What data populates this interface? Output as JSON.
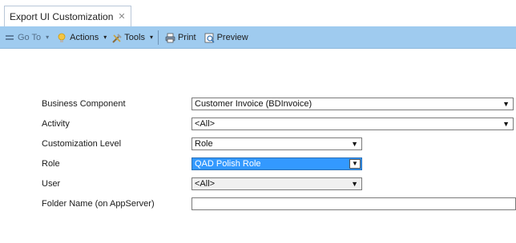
{
  "tab": {
    "title": "Export UI Customization",
    "close": "✕"
  },
  "toolbar": {
    "goto_label": "Go To",
    "actions_label": "Actions",
    "tools_label": "Tools",
    "print_label": "Print",
    "preview_label": "Preview",
    "caret": "▾"
  },
  "form": {
    "business_component": {
      "label": "Business Component",
      "value": "Customer Invoice (BDInvoice)"
    },
    "activity": {
      "label": "Activity",
      "value": "<All>"
    },
    "customization_level": {
      "label": "Customization Level",
      "value": "Role"
    },
    "role": {
      "label": "Role",
      "value": "QAD Polish Role"
    },
    "user": {
      "label": "User",
      "value": "<All>"
    },
    "folder_name": {
      "label": "Folder Name (on AppServer)",
      "value": ""
    }
  },
  "arrow": "▼",
  "colors": {
    "toolbar_bg": "#9fcbef",
    "selection": "#3399ff"
  }
}
